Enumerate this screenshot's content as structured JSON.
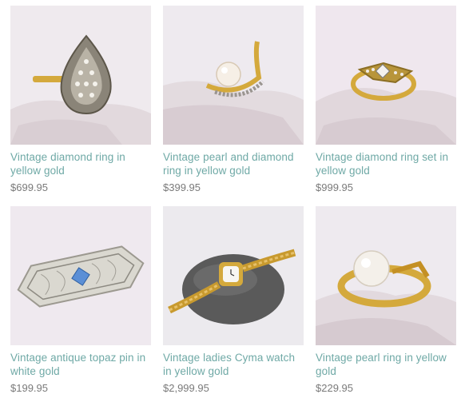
{
  "products": [
    {
      "title": "Vintage diamond ring in yellow gold",
      "price": "$699.95",
      "image_icon": "diamond-cluster-ring"
    },
    {
      "title": "Vintage pearl and diamond ring in yellow gold",
      "price": "$399.95",
      "image_icon": "pearl-bypass-ring"
    },
    {
      "title": "Vintage diamond ring set in yellow gold",
      "price": "$999.95",
      "image_icon": "diamond-ring-set"
    },
    {
      "title": "Vintage antique topaz pin in white gold",
      "price": "$199.95",
      "image_icon": "filigree-bar-pin"
    },
    {
      "title": "Vintage ladies Cyma watch in yellow gold",
      "price": "$2,999.95",
      "image_icon": "ladies-watch"
    },
    {
      "title": "Vintage pearl ring in yellow gold",
      "price": "$229.95",
      "image_icon": "pearl-ring"
    }
  ],
  "colors": {
    "title": "#6fa9a6",
    "price": "#7a7a7a",
    "gold": "#d4a93c",
    "quartz": "#e6dfe3"
  }
}
